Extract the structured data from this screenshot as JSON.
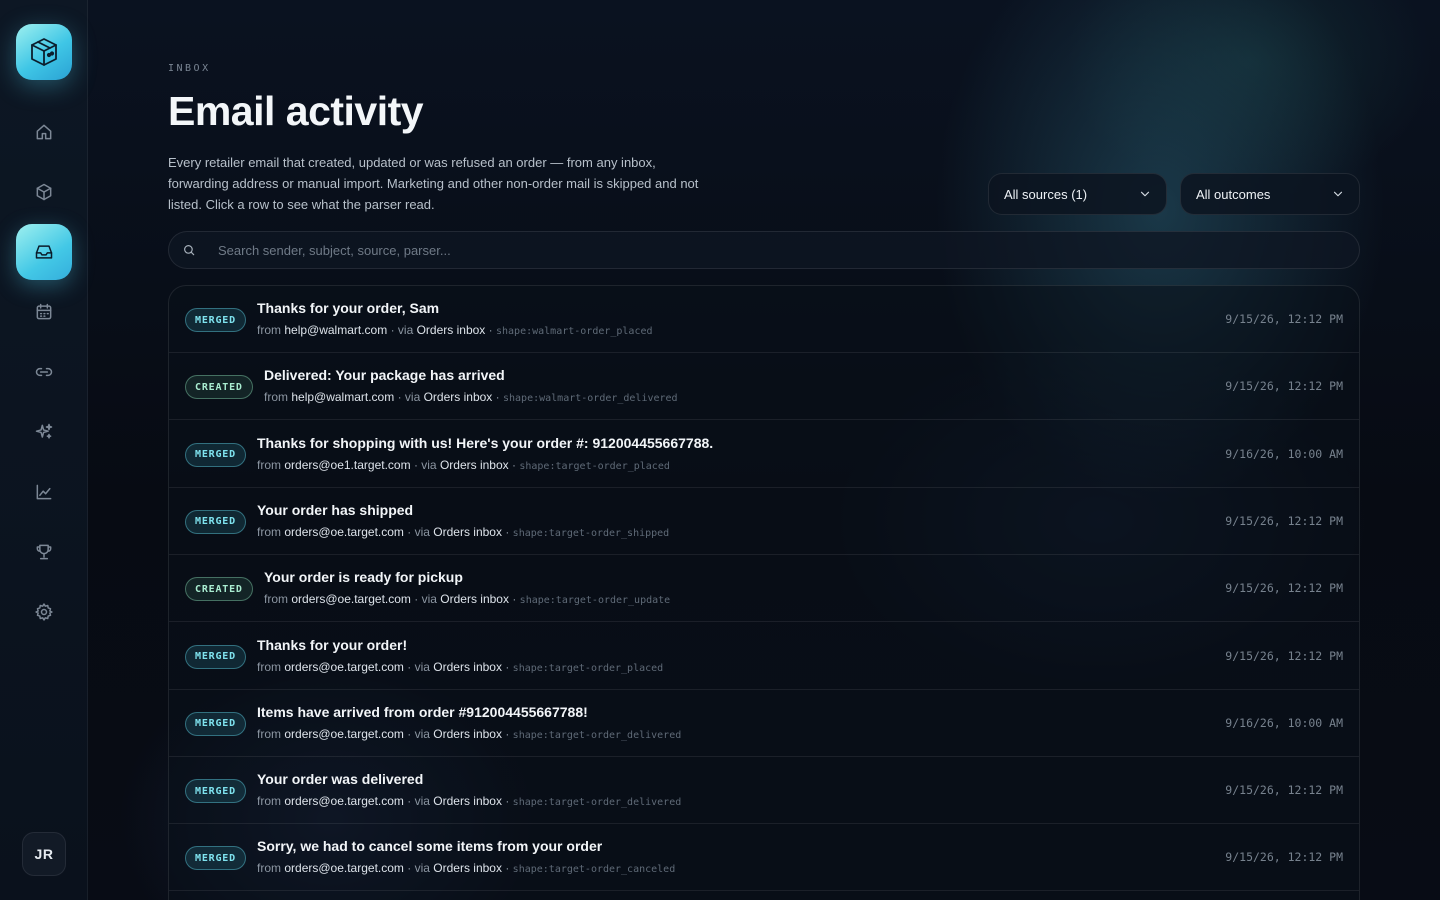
{
  "sidebar": {
    "logo_icon": "box-icon",
    "nav": [
      {
        "id": "home",
        "icon": "home-icon",
        "active": false
      },
      {
        "id": "orders",
        "icon": "package-icon",
        "active": false
      },
      {
        "id": "inbox",
        "icon": "inbox-icon",
        "active": true
      },
      {
        "id": "calendar",
        "icon": "calendar-icon",
        "active": false
      },
      {
        "id": "links",
        "icon": "link-icon",
        "active": false
      },
      {
        "id": "ai",
        "icon": "sparkles-icon",
        "active": false
      },
      {
        "id": "analytics",
        "icon": "chart-icon",
        "active": false
      },
      {
        "id": "rewards",
        "icon": "trophy-icon",
        "active": false
      },
      {
        "id": "settings",
        "icon": "gear-icon",
        "active": false
      }
    ],
    "avatar_initials": "JR"
  },
  "header": {
    "eyebrow": "INBOX",
    "title": "Email activity",
    "description": "Every retailer email that created, updated or was refused an order — from any inbox, forwarding address or manual import. Marketing and other non-order mail is skipped and not listed. Click a row to see what the parser read."
  },
  "filters": {
    "sources": "All sources (1)",
    "outcomes": "All outcomes"
  },
  "search": {
    "placeholder": "Search sender, subject, source, parser..."
  },
  "labels": {
    "from": "from",
    "via": "· via",
    "dot": "·"
  },
  "emails": [
    {
      "status": "MERGED",
      "subject": "Thanks for your order, Sam",
      "from": "help@walmart.com",
      "via": "Orders inbox",
      "shape": "shape:walmart-order_placed",
      "time": "9/15/26, 12:12 PM"
    },
    {
      "status": "CREATED",
      "subject": "Delivered: Your package has arrived",
      "from": "help@walmart.com",
      "via": "Orders inbox",
      "shape": "shape:walmart-order_delivered",
      "time": "9/15/26, 12:12 PM"
    },
    {
      "status": "MERGED",
      "subject": "Thanks for shopping with us! Here's your order #: 912004455667788.",
      "from": "orders@oe1.target.com",
      "via": "Orders inbox",
      "shape": "shape:target-order_placed",
      "time": "9/16/26, 10:00 AM"
    },
    {
      "status": "MERGED",
      "subject": "Your order has shipped",
      "from": "orders@oe.target.com",
      "via": "Orders inbox",
      "shape": "shape:target-order_shipped",
      "time": "9/15/26, 12:12 PM"
    },
    {
      "status": "CREATED",
      "subject": "Your order is ready for pickup",
      "from": "orders@oe.target.com",
      "via": "Orders inbox",
      "shape": "shape:target-order_update",
      "time": "9/15/26, 12:12 PM"
    },
    {
      "status": "MERGED",
      "subject": "Thanks for your order!",
      "from": "orders@oe.target.com",
      "via": "Orders inbox",
      "shape": "shape:target-order_placed",
      "time": "9/15/26, 12:12 PM"
    },
    {
      "status": "MERGED",
      "subject": "Items have arrived from order #912004455667788!",
      "from": "orders@oe.target.com",
      "via": "Orders inbox",
      "shape": "shape:target-order_delivered",
      "time": "9/16/26, 10:00 AM"
    },
    {
      "status": "MERGED",
      "subject": "Your order was delivered",
      "from": "orders@oe.target.com",
      "via": "Orders inbox",
      "shape": "shape:target-order_delivered",
      "time": "9/15/26, 12:12 PM"
    },
    {
      "status": "MERGED",
      "subject": "Sorry, we had to cancel some items from your order",
      "from": "orders@oe.target.com",
      "via": "Orders inbox",
      "shape": "shape:target-order_canceled",
      "time": "9/15/26, 12:12 PM"
    }
  ],
  "colors": {
    "accent": "#43c8e6",
    "merged": "#7fe3ef",
    "created": "#a9ecd0",
    "background": "#070b12"
  }
}
